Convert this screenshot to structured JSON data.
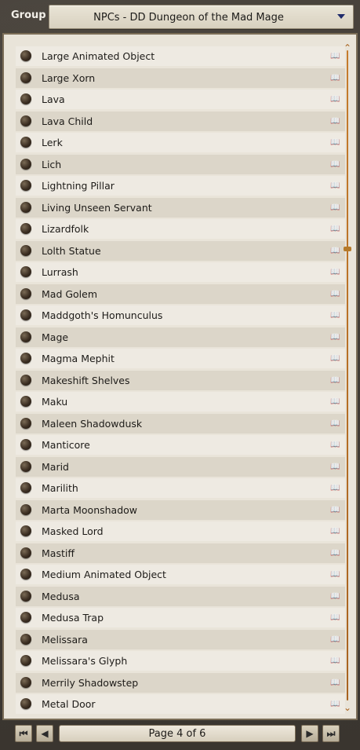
{
  "header": {
    "group_label": "Group",
    "group_value": "NPCs - DD Dungeon of the Mad Mage"
  },
  "list": {
    "items": [
      {
        "name": "Large Animated Object"
      },
      {
        "name": "Large Xorn"
      },
      {
        "name": "Lava"
      },
      {
        "name": "Lava Child"
      },
      {
        "name": "Lerk"
      },
      {
        "name": "Lich"
      },
      {
        "name": "Lightning Pillar"
      },
      {
        "name": "Living Unseen Servant"
      },
      {
        "name": "Lizardfolk"
      },
      {
        "name": "Lolth Statue"
      },
      {
        "name": "Lurrash"
      },
      {
        "name": "Mad Golem"
      },
      {
        "name": "Maddgoth's Homunculus"
      },
      {
        "name": "Mage"
      },
      {
        "name": "Magma Mephit"
      },
      {
        "name": "Makeshift Shelves"
      },
      {
        "name": "Maku"
      },
      {
        "name": "Maleen Shadowdusk"
      },
      {
        "name": "Manticore"
      },
      {
        "name": "Marid"
      },
      {
        "name": "Marilith"
      },
      {
        "name": "Marta Moonshadow"
      },
      {
        "name": "Masked Lord"
      },
      {
        "name": "Mastiff"
      },
      {
        "name": "Medium Animated Object"
      },
      {
        "name": "Medusa"
      },
      {
        "name": "Medusa Trap"
      },
      {
        "name": "Melissara"
      },
      {
        "name": "Melissara's Glyph"
      },
      {
        "name": "Merrily Shadowstep"
      },
      {
        "name": "Metal Door"
      }
    ]
  },
  "pager": {
    "label": "Page 4 of 6"
  },
  "icons": {
    "dropdown": "chevron-down-icon",
    "token": "token-icon",
    "book": "book-icon",
    "first": "first-page-icon",
    "prev": "prev-page-icon",
    "next": "next-page-icon",
    "last": "last-page-icon"
  },
  "colors": {
    "panel_bg": "#e9e4d9",
    "row_alt": "#dcd6c9",
    "frame": "#3f3a33",
    "accent_scroll": "#c57b2b"
  }
}
